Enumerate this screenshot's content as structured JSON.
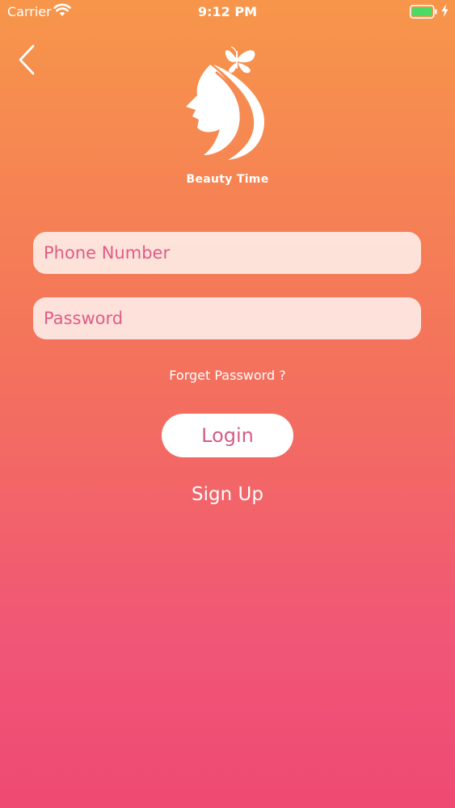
{
  "status_bar": {
    "carrier": "Carrier",
    "time": "9:12 PM",
    "icons": [
      "wifi-icon",
      "battery-icon",
      "charging-bolt-icon"
    ]
  },
  "nav": {
    "back_icon": "chevron-left-icon"
  },
  "brand": {
    "name": "Beauty Time",
    "logo_icon": "woman-profile-butterfly-logo"
  },
  "form": {
    "phone_placeholder": "Phone Number",
    "phone_value": "",
    "password_placeholder": "Password",
    "password_value": ""
  },
  "links": {
    "forgot": "Forget Password ?",
    "signup": "Sign Up"
  },
  "buttons": {
    "login": "Login"
  },
  "colors": {
    "gradient_top": "#f7964a",
    "gradient_bottom": "#ef4a72",
    "accent_text": "#d65c86",
    "battery_fill": "#4cd964"
  }
}
